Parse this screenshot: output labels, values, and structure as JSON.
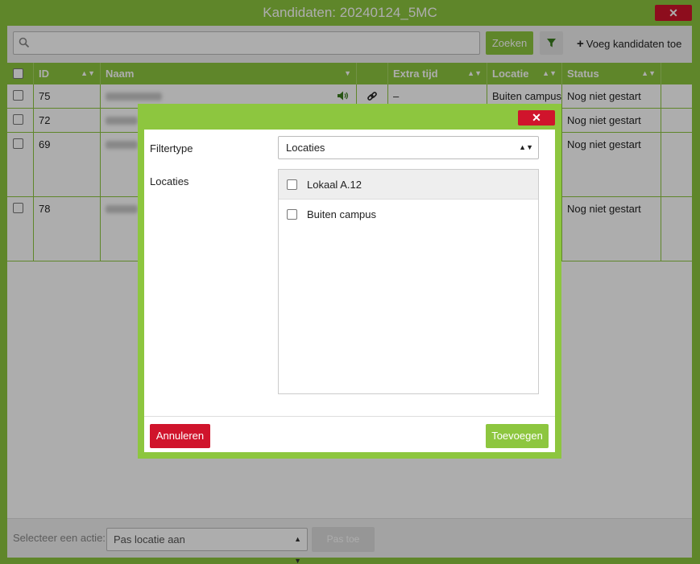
{
  "window": {
    "title": "Kandidaten: 20240124_5MC",
    "close_label": "✕"
  },
  "toolbar": {
    "search_placeholder": "",
    "search_button": "Zoeken",
    "add_button": "Voeg kandidaten toe"
  },
  "table": {
    "columns": [
      "ID",
      "Naam",
      "",
      "Extra tijd",
      "Locatie",
      "Status"
    ],
    "rows": [
      {
        "id": "75",
        "extra_time": "–",
        "location": "Buiten campus",
        "status": "Nog niet gestart",
        "has_audio": true,
        "has_link": true
      },
      {
        "id": "72",
        "extra_time": "",
        "location": "",
        "status": "Nog niet gestart"
      },
      {
        "id": "69",
        "extra_time": "",
        "location": "",
        "status": "Nog niet gestart"
      },
      {
        "id": "78",
        "extra_time": "",
        "location": "",
        "status": "Nog niet gestart"
      }
    ]
  },
  "footer": {
    "action_label": "Selecteer een actie:",
    "action_select_value": "Pas locatie aan",
    "apply_button": "Pas toe"
  },
  "modal": {
    "close_label": "✕",
    "filtertype_label": "Filtertype",
    "filtertype_value": "Locaties",
    "locations_label": "Locaties",
    "locations": [
      "Lokaal A.12",
      "Buiten campus"
    ],
    "cancel_button": "Annuleren",
    "add_button": "Toevoegen"
  },
  "colors": {
    "accent": "#8dc63f",
    "danger": "#d0142c"
  }
}
